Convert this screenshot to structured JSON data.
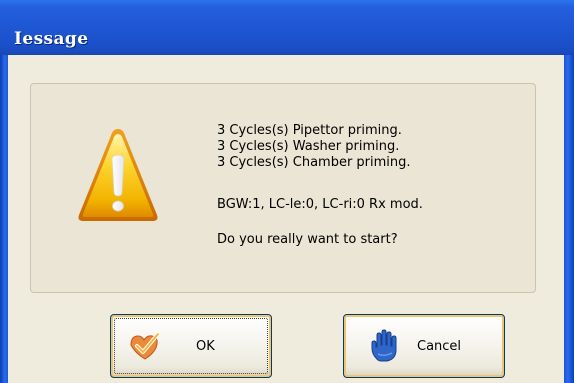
{
  "window": {
    "title": "Iessage"
  },
  "message": {
    "lines": [
      "3 Cycles(s) Pipettor priming.",
      "3 Cycles(s) Washer priming.",
      "3 Cycles(s) Chamber priming.",
      "BGW:1, LC-le:0, LC-ri:0 Rx mod.",
      "Do you really want to start?"
    ],
    "icon": "warning-triangle-icon"
  },
  "buttons": {
    "ok": {
      "label": "OK",
      "icon": "checkmark-icon"
    },
    "cancel": {
      "label": "Cancel",
      "icon": "hand-stop-icon"
    }
  },
  "colors": {
    "titlebar": "#1e56d3",
    "client_background": "#efebdd",
    "button_border": "#003c74",
    "button_focus": "#f1c36b",
    "warning_yellow": "#f2c200",
    "warning_orange": "#e58a00"
  }
}
